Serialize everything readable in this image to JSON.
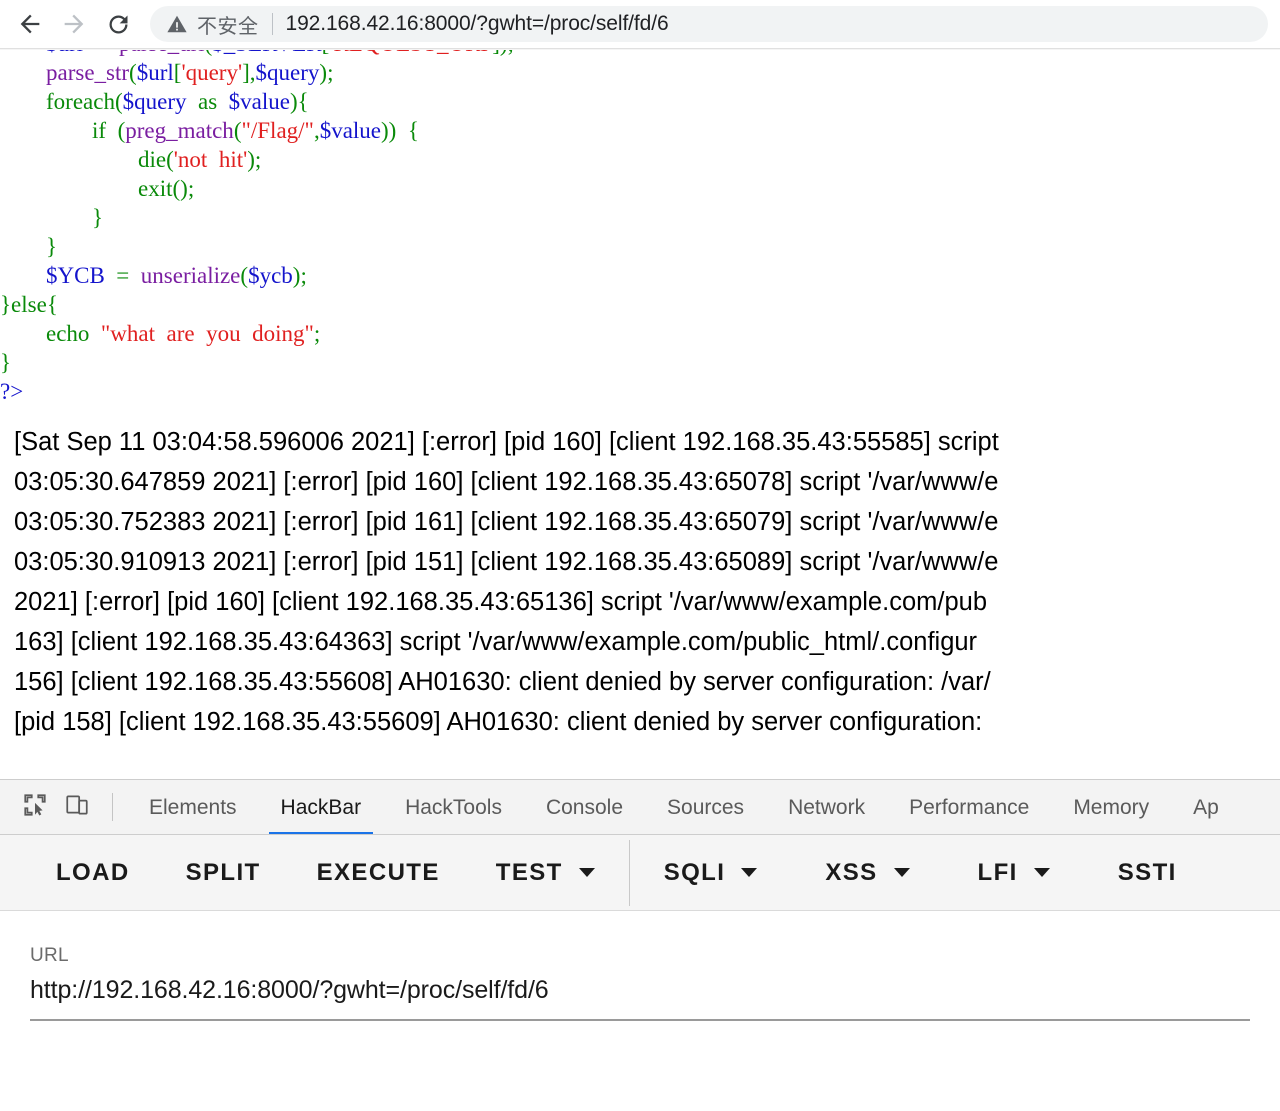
{
  "browser": {
    "back_icon": "back-arrow-icon",
    "forward_icon": "forward-arrow-icon",
    "reload_icon": "reload-icon",
    "warning_icon": "warning-triangle-icon",
    "security_label": "不安全",
    "url": "192.168.42.16:8000/?gwht=/proc/self/fd/6",
    "accent": "#1a73e8"
  },
  "page": {
    "code_lines": [
      [
        {
          "t": "        ",
          "c": "plain"
        },
        {
          "t": "$url",
          "c": "var"
        },
        {
          "t": "  =  ",
          "c": "plain"
        },
        {
          "t": "parse_url",
          "c": "fn"
        },
        {
          "t": "(",
          "c": "punct"
        },
        {
          "t": "$_SERVER",
          "c": "var"
        },
        {
          "t": "[",
          "c": "punct"
        },
        {
          "t": "'REQUEST_URI'",
          "c": "str"
        },
        {
          "t": "])",
          "c": "punct"
        },
        {
          "t": ";",
          "c": "plain"
        }
      ],
      [
        {
          "t": "        ",
          "c": "plain"
        },
        {
          "t": "parse_str",
          "c": "fn"
        },
        {
          "t": "(",
          "c": "punct"
        },
        {
          "t": "$url",
          "c": "var"
        },
        {
          "t": "[",
          "c": "punct"
        },
        {
          "t": "'query'",
          "c": "str"
        },
        {
          "t": "],",
          "c": "punct"
        },
        {
          "t": "$query",
          "c": "var"
        },
        {
          "t": ")",
          "c": "punct"
        },
        {
          "t": ";",
          "c": "plain"
        }
      ],
      [
        {
          "t": "        ",
          "c": "plain"
        },
        {
          "t": "foreach",
          "c": "kw"
        },
        {
          "t": "(",
          "c": "punct"
        },
        {
          "t": "$query",
          "c": "var"
        },
        {
          "t": "  as  ",
          "c": "kw"
        },
        {
          "t": "$value",
          "c": "var"
        },
        {
          "t": "){",
          "c": "punct"
        }
      ],
      [
        {
          "t": "                ",
          "c": "plain"
        },
        {
          "t": "if",
          "c": "kw"
        },
        {
          "t": "  (",
          "c": "punct"
        },
        {
          "t": "preg_match",
          "c": "fn"
        },
        {
          "t": "(",
          "c": "punct"
        },
        {
          "t": "\"/Flag/\"",
          "c": "str"
        },
        {
          "t": ",",
          "c": "punct"
        },
        {
          "t": "$value",
          "c": "var"
        },
        {
          "t": "))  {",
          "c": "punct"
        }
      ],
      [
        {
          "t": "                        ",
          "c": "plain"
        },
        {
          "t": "die",
          "c": "kw"
        },
        {
          "t": "(",
          "c": "punct"
        },
        {
          "t": "'not  hit'",
          "c": "str"
        },
        {
          "t": ")",
          "c": "punct"
        },
        {
          "t": ";",
          "c": "plain"
        }
      ],
      [
        {
          "t": "                        ",
          "c": "plain"
        },
        {
          "t": "exit",
          "c": "kw"
        },
        {
          "t": "()",
          "c": "punct"
        },
        {
          "t": ";",
          "c": "plain"
        }
      ],
      [
        {
          "t": "                ",
          "c": "plain"
        },
        {
          "t": "}",
          "c": "punct"
        }
      ],
      [
        {
          "t": "        ",
          "c": "plain"
        },
        {
          "t": "}",
          "c": "punct"
        }
      ],
      [
        {
          "t": "        ",
          "c": "plain"
        },
        {
          "t": "$YCB",
          "c": "var"
        },
        {
          "t": "  =  ",
          "c": "plain"
        },
        {
          "t": "unserialize",
          "c": "fn"
        },
        {
          "t": "(",
          "c": "punct"
        },
        {
          "t": "$ycb",
          "c": "var"
        },
        {
          "t": ")",
          "c": "punct"
        },
        {
          "t": ";",
          "c": "plain"
        }
      ],
      [
        {
          "t": "}",
          "c": "punct"
        },
        {
          "t": "else",
          "c": "kw"
        },
        {
          "t": "{",
          "c": "punct"
        }
      ],
      [
        {
          "t": "        ",
          "c": "plain"
        },
        {
          "t": "echo",
          "c": "kw"
        },
        {
          "t": "  ",
          "c": "plain"
        },
        {
          "t": "\"what  are  you  doing\"",
          "c": "str"
        },
        {
          "t": ";",
          "c": "plain"
        }
      ],
      [
        {
          "t": "}",
          "c": "punct"
        }
      ],
      [
        {
          "t": "?>",
          "c": "tag"
        }
      ]
    ],
    "log_lines": [
      "[Sat Sep 11 03:04:58.596006 2021] [:error] [pid 160] [client 192.168.35.43:55585] script",
      "03:05:30.647859 2021] [:error] [pid 160] [client 192.168.35.43:65078] script '/var/www/e",
      "03:05:30.752383 2021] [:error] [pid 161] [client 192.168.35.43:65079] script '/var/www/e",
      "03:05:30.910913 2021] [:error] [pid 151] [client 192.168.35.43:65089] script '/var/www/e",
      "2021] [:error] [pid 160] [client 192.168.35.43:65136] script '/var/www/example.com/pub",
      "163] [client 192.168.35.43:64363] script '/var/www/example.com/public_html/.configur",
      "156] [client 192.168.35.43:55608] AH01630: client denied by server configuration: /var/",
      "[pid 158] [client 192.168.35.43:55609] AH01630: client denied by server configuration:"
    ]
  },
  "devtools": {
    "inspect_icon": "inspect-element-icon",
    "device_icon": "device-toolbar-icon",
    "tabs": [
      {
        "label": "Elements",
        "active": false
      },
      {
        "label": "HackBar",
        "active": true
      },
      {
        "label": "HackTools",
        "active": false
      },
      {
        "label": "Console",
        "active": false
      },
      {
        "label": "Sources",
        "active": false
      },
      {
        "label": "Network",
        "active": false
      },
      {
        "label": "Performance",
        "active": false
      },
      {
        "label": "Memory",
        "active": false
      },
      {
        "label": "Ap",
        "active": false
      }
    ]
  },
  "hackbar": {
    "buttons": [
      {
        "label": "LOAD",
        "caret": false
      },
      {
        "label": "SPLIT",
        "caret": false
      },
      {
        "label": "EXECUTE",
        "caret": false
      },
      {
        "label": "TEST",
        "caret": true
      },
      {
        "label": "SQLI",
        "caret": true
      },
      {
        "label": "XSS",
        "caret": true
      },
      {
        "label": "LFI",
        "caret": true
      },
      {
        "label": "SSTI",
        "caret": false
      }
    ],
    "url_field": {
      "label": "URL",
      "value": "http://192.168.42.16:8000/?gwht=/proc/self/fd/6"
    }
  }
}
